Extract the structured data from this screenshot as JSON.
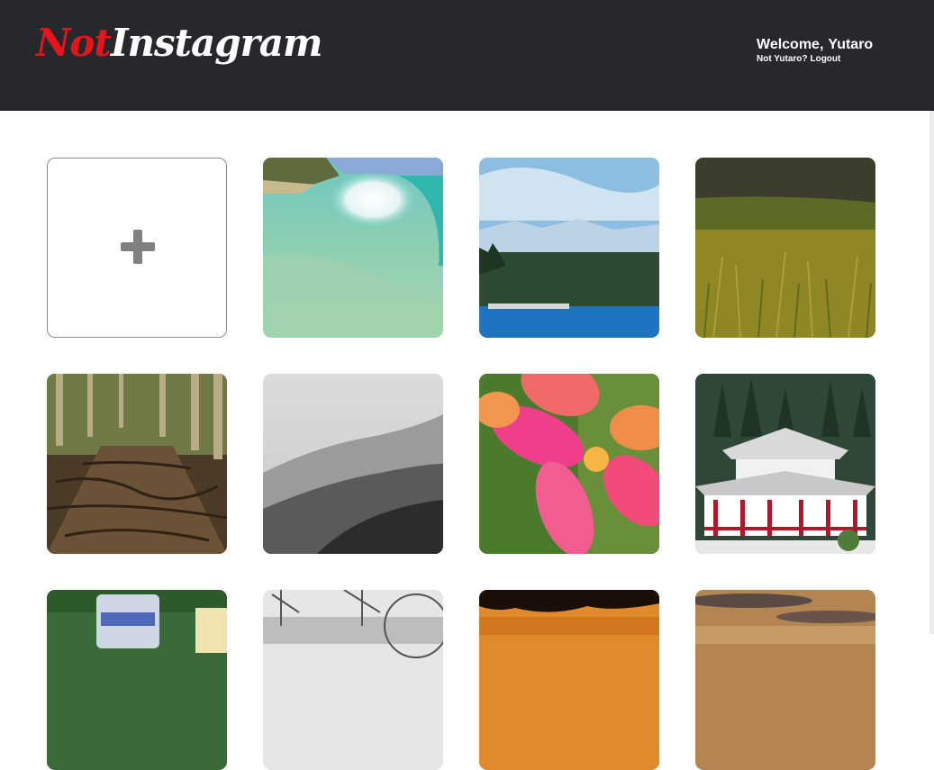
{
  "header": {
    "logo": {
      "part1": "Not",
      "part2": "Instagram",
      "accent_color": "#e8141b"
    },
    "welcome_prefix": "Welcome,",
    "username": "Yutaro",
    "not_user_text": "Not Yutaro?",
    "logout_label": "Logout",
    "background": "#26282c"
  },
  "gallery": {
    "add_tile": {
      "icon": "plus-icon"
    },
    "photos": [
      {
        "subject": "ocean-wave"
      },
      {
        "subject": "mountain-lake"
      },
      {
        "subject": "grass-field"
      },
      {
        "subject": "forest-roots-path"
      },
      {
        "subject": "misty-mountain-bw"
      },
      {
        "subject": "plumeria-flower"
      },
      {
        "subject": "japanese-temple"
      },
      {
        "subject": "beverage-can"
      },
      {
        "subject": "harbor-cranes-bw"
      },
      {
        "subject": "sunset-tree-silhouette"
      },
      {
        "subject": "cloudy-sunset-sky"
      }
    ]
  }
}
